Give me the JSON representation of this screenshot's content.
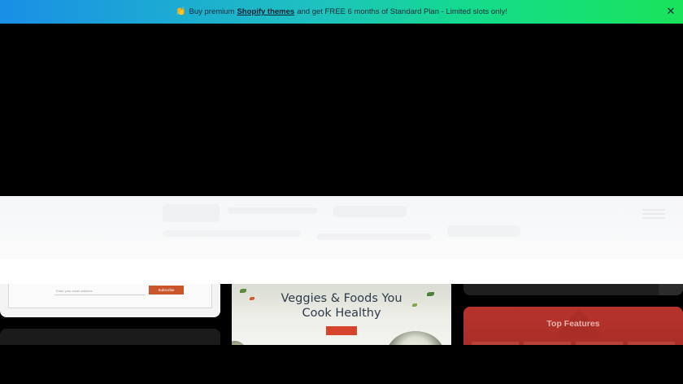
{
  "promo": {
    "emoji": "👏",
    "text_before": "Buy premium",
    "link_label": "Shopify themes",
    "text_after": "and get FREE 6 months of Standard Plan - Limited slots only!",
    "close_glyph": "✕"
  },
  "cards": {
    "newsletter": {
      "email_placeholder": "Enter your email address",
      "subscribe_label": "Subscribe"
    },
    "veggies": {
      "tag": "",
      "title_line1": "Veggies & Foods You",
      "title_line2": "Cook Healthy",
      "button_label": ""
    },
    "features": {
      "title": "Top Features",
      "subtitle": ""
    }
  },
  "colors": {
    "promo_gradient_start": "#1a8fe6",
    "promo_gradient_end": "#19e25a",
    "subscribe_button": "#c9562a",
    "veggies_button": "#d6442b",
    "features_card": "#b6332c"
  },
  "icons": {
    "promo": "clapping-hands-icon",
    "close": "close-icon"
  }
}
